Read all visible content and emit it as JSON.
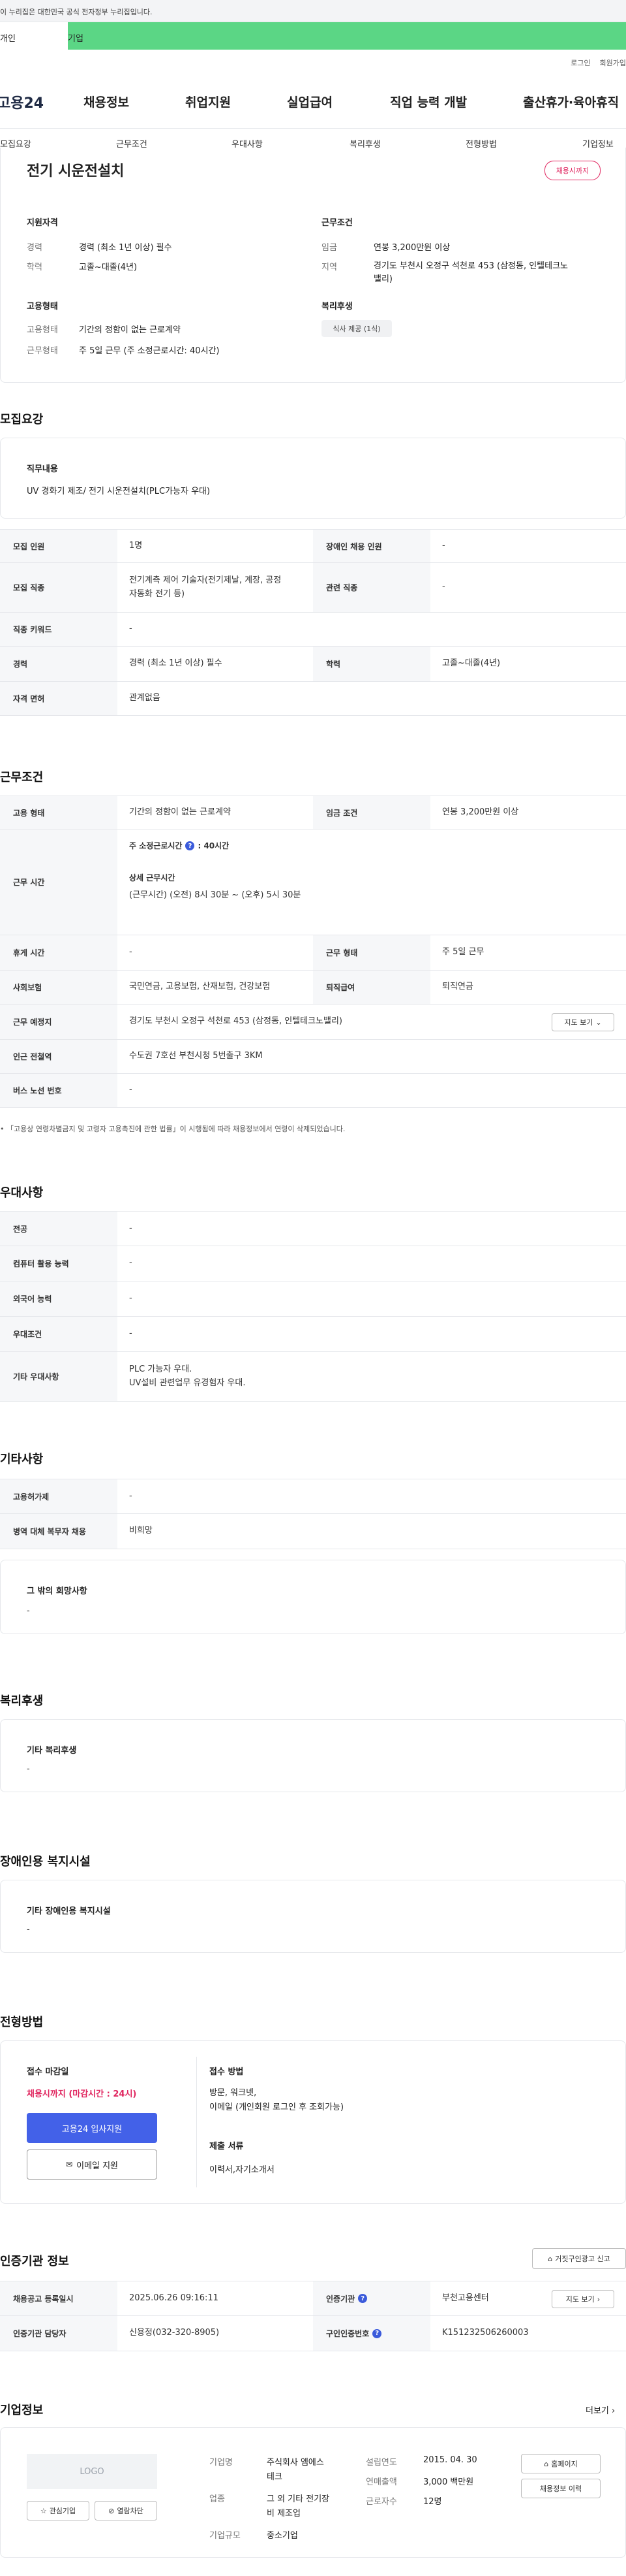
{
  "gov_banner": "이 누리집은 대한민국 공식 전자정부 누리집입니다.",
  "tabs": {
    "personal": "개인",
    "corporate": "기업"
  },
  "top_links": {
    "login": "로그인",
    "signup": "회원가입"
  },
  "logo": "고용24",
  "gnb": [
    "채용정보",
    "취업지원",
    "실업급여",
    "직업 능력 개발",
    "출산휴가·육아휴직"
  ],
  "subnav": [
    "모집요강",
    "근무조건",
    "우대사항",
    "복리후생",
    "전형방법",
    "기업정보"
  ],
  "summary": {
    "title": "전기 시운전설치",
    "status_badge": "채용시까지",
    "qualification_heading": "지원자격",
    "experience_label": "경력",
    "experience_value": "경력 (최소 1년 이상) 필수",
    "education_label": "학력",
    "education_value": "고졸~대졸(4년)",
    "employment_heading": "고용형태",
    "emp_type_label": "고용형태",
    "emp_type_value": "기간의 정함이 없는 근로계약",
    "work_form_label": "근무형태",
    "work_form_value": "주 5일 근무 (주 소정근로시간: 40시간)",
    "conditions_heading": "근무조건",
    "wage_label": "임금",
    "wage_value": "연봉 3,200만원 이상",
    "region_label": "지역",
    "region_value_1": "경기도 부천시 오정구 석천로 453 (삼정동, 인텔테크노",
    "region_value_2": "밸리)",
    "welfare_heading": "복리후생",
    "welfare_chip": "식사 제공 (1식)"
  },
  "recruit": {
    "section_title": "모집요강",
    "job_heading": "직무내용",
    "job_desc": "UV 경화기 제조/ 전기 시운전설치(PLC가능자 우대)",
    "rows": {
      "headcount_label": "모집 인원",
      "headcount_value": "1명",
      "disabled_label": "장애인 채용 인원",
      "disabled_value": "-",
      "job_label": "모집 직종",
      "job_value_1": "전기계측 제어 기술자(전기제날, 계장, 공정",
      "job_value_2": "자동화 전기 등)",
      "related_label": "관련 직종",
      "related_value": "-",
      "keyword_label": "직종 키워드",
      "keyword_value": "-",
      "career_label": "경력",
      "career_value": "경력 (최소 1년 이상) 필수",
      "edu_label": "학력",
      "edu_value": "고졸~대졸(4년)",
      "license_label": "자격 면허",
      "license_value": "관계없음"
    }
  },
  "conditions": {
    "section_title": "근무조건",
    "emp_type_label": "고용 형태",
    "emp_type_value": "기간의 정함이 없는 근로계약",
    "wage_label": "임금 조건",
    "wage_value": "연봉 3,200만원 이상",
    "hours_label": "근무 시간",
    "hours_weekly_label": "주 소정근로시간",
    "hours_weekly_value": ": 40시간",
    "hours_detail_label": "상세 근무시간",
    "hours_detail_value": "(근무시간) (오전) 8시 30분 ~ (오후) 5시 30분",
    "rest_label": "휴게 시간",
    "rest_value": "-",
    "work_form_label": "근무 형태",
    "work_form_value": "주 5일 근무",
    "insurance_label": "사회보험",
    "insurance_value": "국민연금, 고용보험, 산재보험, 건강보험",
    "severance_label": "퇴직급여",
    "severance_value": "퇴직연금",
    "location_label": "근무 예정지",
    "location_value": "경기도 부천시 오정구 석천로 453 (삼정동, 인텔테크노밸리)",
    "map_button": "지도 보기",
    "subway_label": "인근 전철역",
    "subway_value": "수도권 7호선 부천시청 5번출구 3KM",
    "bus_label": "버스 노선 번호",
    "bus_value": "-",
    "footnote": "「고용상 연령차별금지 및 고령자 고용촉진에 관한 법률」이 시행됨에 따라 채용정보에서 연령이 삭제되었습니다."
  },
  "preference": {
    "section_title": "우대사항",
    "major_label": "전공",
    "major_value": "-",
    "computer_label": "컴퓨터 활용 능력",
    "computer_value": "-",
    "language_label": "외국어 능력",
    "language_value": "-",
    "cond_label": "우대조건",
    "cond_value": "-",
    "etc_label": "기타 우대사항",
    "etc_value_1": "PLC 가능자 우대.",
    "etc_value_2": "UV설비 관련업무 유경험자 우대."
  },
  "others": {
    "section_title": "기타사항",
    "permit_label": "고용허가제",
    "permit_value": "-",
    "military_label": "병역 대체 복무자 채용",
    "military_value": "비희망",
    "other_wish_heading": "그 밖의 희망사항",
    "other_wish_value": "-"
  },
  "welfare": {
    "section_title": "복리후생",
    "heading": "기타 복리후생",
    "value": "-"
  },
  "disability": {
    "section_title": "장애인용 복지시설",
    "heading": "기타 장애인용 복지시설",
    "value": "-"
  },
  "selection": {
    "section_title": "전형방법",
    "deadline_heading": "접수 마감일",
    "deadline_value": "채용시까지 (마감시간 : 24시)",
    "apply_button": "고용24 입사지원",
    "email_button": "이메일 지원",
    "method_heading": "접수 방법",
    "method_value_1": "방문, 워크넷,",
    "method_value_2": "이메일 (개인회원 로그인 후 조회가능)",
    "docs_heading": "제출 서류",
    "docs_value": "이력서,자기소개서"
  },
  "certification": {
    "section_title": "인증기관 정보",
    "report_button": "거짓구인광고 신고",
    "reg_date_label": "채용공고 등록일시",
    "reg_date_value": "2025.06.26 09:16:11",
    "agency_label": "인증기관",
    "agency_value": "부천고용센터",
    "manager_label": "인증기관 담당자",
    "manager_value": "신용정(032-320-8905)",
    "cert_no_label": "구인인증번호",
    "cert_no_value": "K151232506260003",
    "map_button": "지도 보기"
  },
  "company": {
    "section_title": "기업정보",
    "more_link": "더보기",
    "logo_text": "LOGO",
    "interest_button": "관심기업",
    "block_button": "열람차단",
    "name_label": "기업명",
    "name_value_1": "주식회사 엠에스",
    "name_value_2": "테크",
    "industry_label": "업종",
    "industry_value_1": "그 외 기타 전기장",
    "industry_value_2": "비 제조업",
    "scale_label": "기업규모",
    "scale_value": "중소기업",
    "founded_label": "설립연도",
    "founded_value": "2015. 04. 30",
    "revenue_label": "연매출액",
    "revenue_value": "3,000 백만원",
    "employees_label": "근로자수",
    "employees_value": "12명",
    "homepage_button": "홈페이지",
    "history_button": "채용정보 이력"
  }
}
